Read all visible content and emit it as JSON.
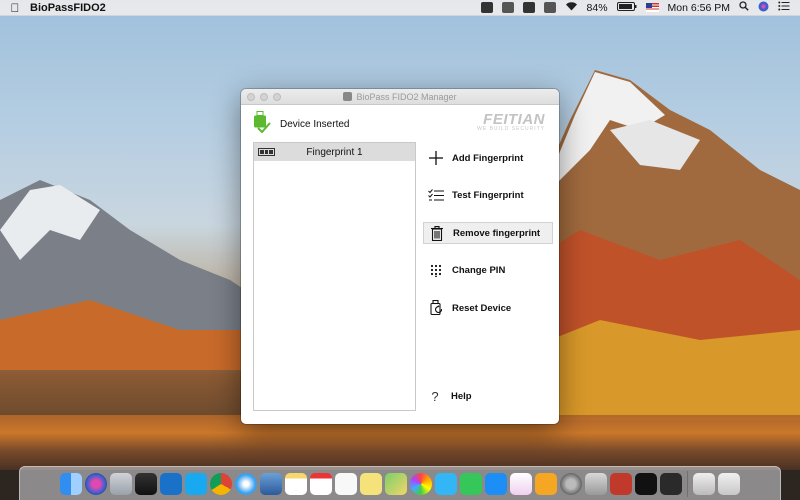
{
  "menubar": {
    "app_name": "BioPassFIDO2",
    "battery": "84%",
    "clock": "Mon 6:56 PM"
  },
  "window": {
    "title": "BioPass FIDO2 Manager",
    "status_label": "Device Inserted",
    "brand": "FEITIAN",
    "brand_tagline": "WE BUILD SECURITY"
  },
  "fingerprints": [
    {
      "label": "Fingerprint 1"
    }
  ],
  "actions": {
    "add": "Add Fingerprint",
    "test": "Test Fingerprint",
    "remove": "Remove fingerprint",
    "pin": "Change PIN",
    "reset": "Reset Device"
  },
  "help_label": "Help",
  "colors": {
    "status_green": "#5cb82e",
    "selected_row": "#dcdcdc",
    "brand_gray": "#c3c3c3"
  },
  "dock": {
    "icons": [
      "finder-icon",
      "siri-icon",
      "launchpad-icon",
      "mission-control-icon",
      "skype-business-icon",
      "skype-icon",
      "chrome-icon",
      "safari-icon",
      "preview-icon",
      "notes-icon",
      "calendar-icon",
      "reminders-icon",
      "stickies-icon",
      "maps-icon",
      "photos-icon",
      "messages-icon",
      "facetime-icon",
      "app-store-icon",
      "itunes-icon",
      "ibooks-icon",
      "system-preferences-icon",
      "keychain-icon",
      "photo-booth-icon",
      "terminal-icon",
      "biopass-icon",
      "archive-icon",
      "trash-icon"
    ]
  }
}
